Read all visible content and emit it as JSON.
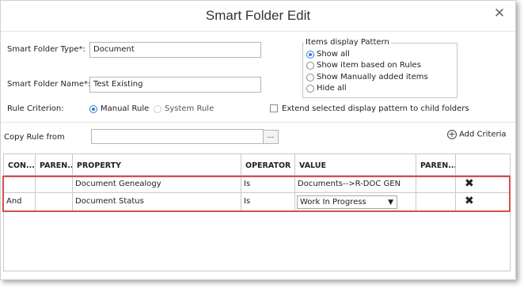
{
  "dialog": {
    "title": "Smart Folder Edit",
    "close_glyph": "✕"
  },
  "form": {
    "folder_type_label": "Smart Folder Type*:",
    "folder_type_value": "Document",
    "folder_name_label": "Smart Folder Name*:",
    "folder_name_value": "Test Existing",
    "rule_criterion_label": "Rule Criterion:",
    "rule_options": [
      {
        "label": "Manual Rule",
        "checked": true
      },
      {
        "label": "System Rule",
        "checked": false
      }
    ],
    "extend_label": "Extend selected display pattern to child folders",
    "extend_checked": false,
    "copy_rule_label": "Copy Rule from",
    "copy_rule_value": "",
    "browse_label": "...",
    "add_criteria_label": "Add Criteria"
  },
  "display_pattern": {
    "legend": "Items display Pattern",
    "options": [
      {
        "label": "Show all",
        "checked": true
      },
      {
        "label": "Show item based on Rules",
        "checked": false
      },
      {
        "label": "Show Manually added items",
        "checked": false
      },
      {
        "label": "Hide all",
        "checked": false
      }
    ]
  },
  "grid": {
    "columns": [
      "CON...",
      "PAREN...",
      "PROPERTY",
      "OPERATOR",
      "VALUE",
      "PAREN...",
      ""
    ],
    "rows": [
      {
        "connector": "",
        "paren_open": "",
        "property": "Document Genealogy",
        "operator": "Is",
        "value": "Documents-->R-DOC GEN",
        "paren_close": "",
        "delete": "✖"
      },
      {
        "connector": "And",
        "paren_open": "",
        "property": "Document Status",
        "operator": "Is",
        "value": "Work In Progress",
        "paren_close": "",
        "delete": "✖"
      }
    ]
  },
  "colors": {
    "accent": "#2f7fd6",
    "highlight": "#d6504c"
  }
}
